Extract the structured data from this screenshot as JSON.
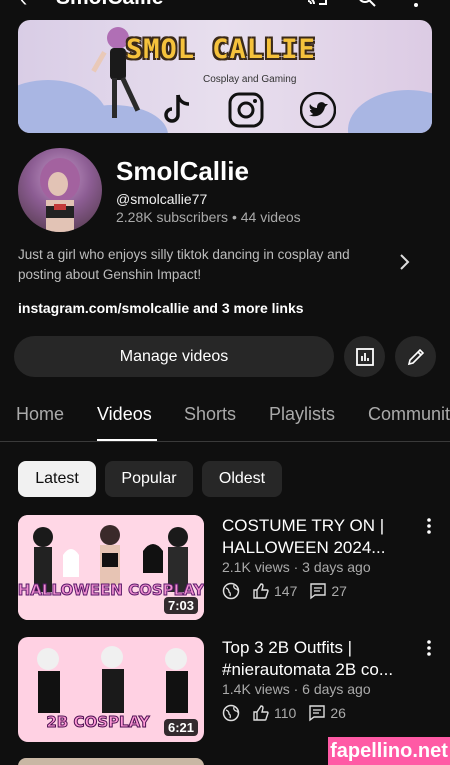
{
  "header": {
    "title": "SmolCallie"
  },
  "banner": {
    "title": "SMOL CALLIE",
    "subtitle": "Cosplay and Gaming"
  },
  "channel": {
    "name": "SmolCallie",
    "handle": "@smolcallie77",
    "stats": "2.28K subscribers  •  44 videos",
    "description": "Just a girl who enjoys silly tiktok dancing in cosplay and posting about Genshin Impact!",
    "links": "instagram.com/smolcallie and 3 more links"
  },
  "actions": {
    "manage_label": "Manage videos"
  },
  "tabs": [
    {
      "label": "Home"
    },
    {
      "label": "Videos"
    },
    {
      "label": "Shorts"
    },
    {
      "label": "Playlists"
    },
    {
      "label": "Community"
    }
  ],
  "filters": [
    {
      "label": "Latest"
    },
    {
      "label": "Popular"
    },
    {
      "label": "Oldest"
    }
  ],
  "videos": [
    {
      "title": "COSTUME TRY ON | HALLOWEEN 2024...",
      "meta": "2.1K views · 3 days ago",
      "likes": "147",
      "comments": "27",
      "duration": "7:03",
      "thumb_text": "HALLOWEEN COSPLAY"
    },
    {
      "title": "Top 3 2B Outfits | #nierautomata 2B co...",
      "meta": "1.4K views · 6 days ago",
      "likes": "110",
      "comments": "26",
      "duration": "6:21",
      "thumb_text": "2B COSPLAY"
    }
  ],
  "watermark": "fapellino.net",
  "colors": {
    "background": "#0f0f0f",
    "chip_active": "#f1f1f1",
    "button": "#272727",
    "banner_title": "#f5c23c",
    "watermark": "#ff5aa5"
  }
}
